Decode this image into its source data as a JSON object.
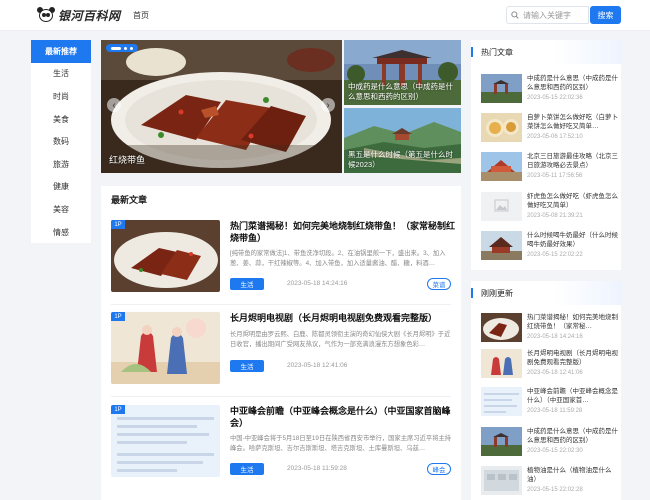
{
  "header": {
    "logo_text": "银河百科网",
    "nav_home": "首页",
    "search_placeholder": "请输入关键字",
    "search_button": "搜索"
  },
  "sidebar": {
    "items": [
      "最新推荐",
      "生活",
      "时尚",
      "美食",
      "数码",
      "旅游",
      "健康",
      "美容",
      "情感"
    ]
  },
  "banner": {
    "main_caption": "红烧带鱼",
    "side_captions": [
      "中成药是什么意思（中成药是什么意思和西药的区别）",
      "黑五是什么时候（第五是什么时候2023）"
    ]
  },
  "latest": {
    "title": "最新文章",
    "articles": [
      {
        "badge": "1P",
        "title": "热门菜谱揭秘！如何完美地烧制红烧带鱼！（家常秘制红烧带鱼）",
        "desc": "[纯带鱼的家常做法]1、带鱼洗净切段。2、在油锅里煎一下，盛出来。3、加入葱、姜、蒜，干红辣椒等。4、加入带鱼，加入适量酱油、醋、糖，料酒…",
        "tag": "生活",
        "date": "2023-05-18 14:24:16",
        "pill": "菜谱"
      },
      {
        "badge": "1P",
        "title": "长月烬明电视剧（长月烬明电视剧免费观看完整版）",
        "desc": "长月烬明是由罗云熙、白鹿、陈都灵领衔主演的奇幻仙侠大剧《长月烬明》于近日收官，播出期间广受网友热议，气作为一部充满浪漫东方想象色彩…",
        "tag": "生活",
        "date": "2023-05-18 12:41:06",
        "pill": ""
      },
      {
        "badge": "1P",
        "title": "中亚峰会前瞻（中亚峰会概念是什么）（中亚国家首脑峰会）",
        "desc": "中国-中亚峰会将于5月18日至19日在陕西省西安市举行，国家主席习近平将主持峰会。哈萨克斯坦、吉尔吉斯斯坦、塔吉克斯坦、土库曼斯坦、乌兹…",
        "tag": "生活",
        "date": "2023-05-18 11:59:28",
        "pill": "峰会"
      }
    ]
  },
  "hot": {
    "title": "热门文章",
    "items": [
      {
        "title": "中成药是什么意思（中成药是什么意思和西药的区别）",
        "date": "2023-05-15 22:02:36"
      },
      {
        "title": "自萝卜菜饼怎么做好吃（白萝卜菜饼怎么做好吃又简单…",
        "date": "2023-05-06 17:52:10"
      },
      {
        "title": "北京三日旅游最佳攻略（北京三日旅游攻略必去景点）",
        "date": "2023-05-11 17:56:56"
      },
      {
        "title": "虾虎鱼怎么做好吃（虾虎鱼怎么做好吃又简单）",
        "date": "2023-05-08 21:39:21"
      },
      {
        "title": "什么时候喝牛奶最好（什么时候喝牛奶最好效果）",
        "date": "2023-05-15 22:02:22"
      }
    ]
  },
  "recent": {
    "title": "刚刚更新",
    "items": [
      {
        "title": "热门菜谱揭秘！如何完美地烧制红烧带鱼！（家常秘…",
        "date": "2023-05-18 14:24:16"
      },
      {
        "title": "长月烬明电视剧（长月烬明电视剧免费观看完整版）",
        "date": "2023-05-18 12:41:06"
      },
      {
        "title": "中亚峰会前瞻（中亚峰会概念是什么）（中亚国家首…",
        "date": "2023-05-18 11:59:28"
      },
      {
        "title": "中成药是什么意思（中成药是什么意思和西药的区别）",
        "date": "2023-05-15 22:02:30"
      },
      {
        "title": "植物油是什么（植物油是什么油）",
        "date": "2023-05-15 22:02:28"
      }
    ]
  },
  "colors": {
    "accent": "#1e78f0",
    "background": "#f2f4f7"
  },
  "icons": {
    "search": "search-icon",
    "logo": "panda-logo-icon"
  }
}
